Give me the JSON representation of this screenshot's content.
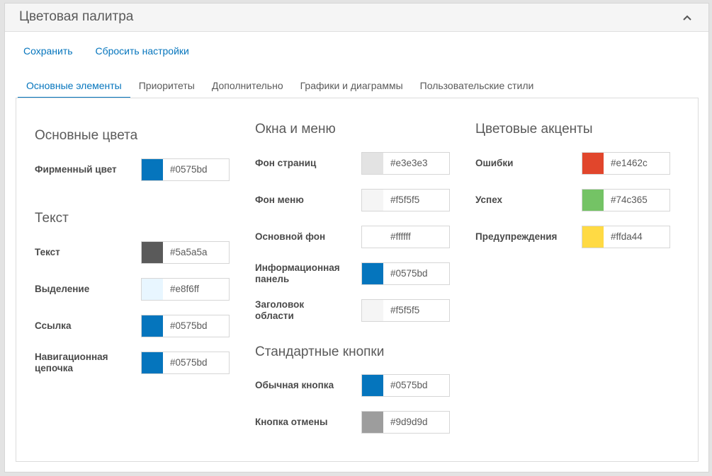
{
  "panel": {
    "title": "Цветовая палитра"
  },
  "actions": {
    "save": "Сохранить",
    "reset": "Сбросить настройки"
  },
  "tabs": [
    {
      "label": "Основные элементы",
      "active": true
    },
    {
      "label": "Приоритеты"
    },
    {
      "label": "Дополнительно"
    },
    {
      "label": "Графики и диаграммы"
    },
    {
      "label": "Пользовательские стили"
    }
  ],
  "col1": {
    "main_colors": {
      "title": "Основные цвета",
      "items": [
        {
          "label": "Фирменный цвет",
          "color": "#0575bd",
          "hex": "#0575bd"
        }
      ]
    },
    "text": {
      "title": "Текст",
      "items": [
        {
          "label": "Текст",
          "color": "#5a5a5a",
          "hex": "#5a5a5a"
        },
        {
          "label": "Выделение",
          "color": "#e8f6ff",
          "hex": "#e8f6ff"
        },
        {
          "label": "Ссылка",
          "color": "#0575bd",
          "hex": "#0575bd"
        },
        {
          "label": "Навигационная цепочка",
          "color": "#0575bd",
          "hex": "#0575bd"
        }
      ]
    }
  },
  "col2": {
    "windows": {
      "title": "Окна и меню",
      "items": [
        {
          "label": "Фон страниц",
          "color": "#e3e3e3",
          "hex": "#e3e3e3"
        },
        {
          "label": "Фон меню",
          "color": "#f5f5f5",
          "hex": "#f5f5f5"
        },
        {
          "label": "Основной фон",
          "color": "#ffffff",
          "hex": "#ffffff"
        },
        {
          "label": "Информационная панель",
          "color": "#0575bd",
          "hex": "#0575bd"
        },
        {
          "label": "Заголовок области",
          "color": "#f5f5f5",
          "hex": "#f5f5f5"
        }
      ]
    },
    "buttons": {
      "title": "Стандартные кнопки",
      "items": [
        {
          "label": "Обычная кнопка",
          "color": "#0575bd",
          "hex": "#0575bd"
        },
        {
          "label": "Кнопка отмены",
          "color": "#9d9d9d",
          "hex": "#9d9d9d"
        }
      ]
    }
  },
  "col3": {
    "accents": {
      "title": "Цветовые акценты",
      "items": [
        {
          "label": "Ошибки",
          "color": "#e1462c",
          "hex": "#e1462c"
        },
        {
          "label": "Успех",
          "color": "#74c365",
          "hex": "#74c365"
        },
        {
          "label": "Предупреждения",
          "color": "#ffda44",
          "hex": "#ffda44"
        }
      ]
    }
  }
}
